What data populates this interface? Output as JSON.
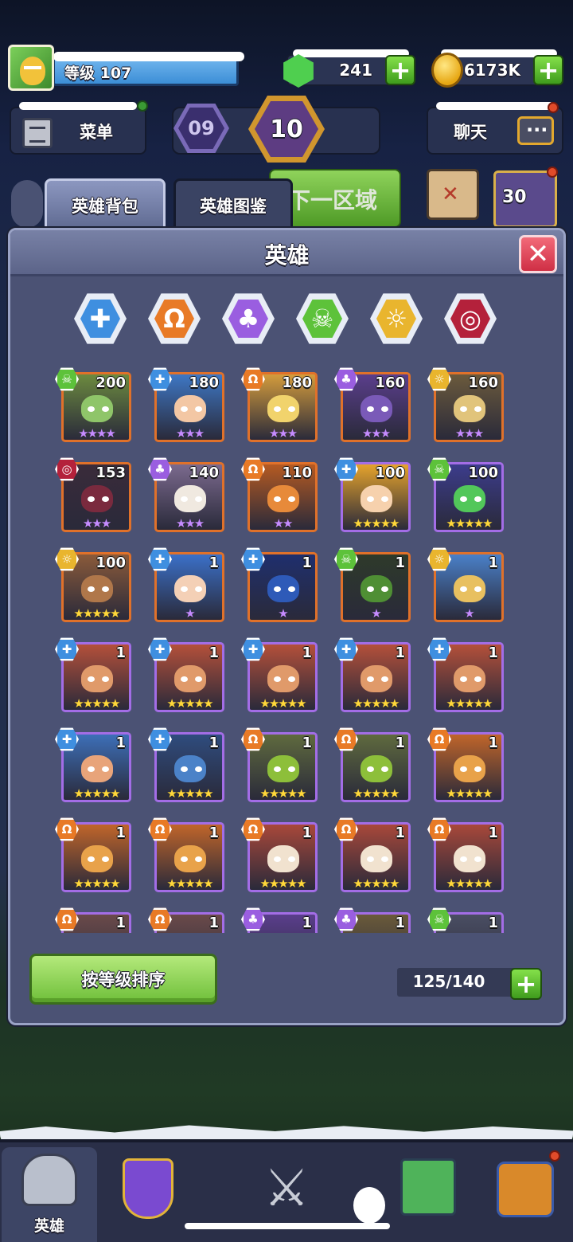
{
  "hud": {
    "level_label": "等级",
    "level_value": "107",
    "gems": "241",
    "gold": "6173K"
  },
  "top_buttons": {
    "menu": "菜单",
    "chat": "聊天",
    "stage_prev": "09",
    "stage_current": "10",
    "next_zone": "下一区域",
    "event_days": "30"
  },
  "tabs": {
    "backpack": "英雄背包",
    "codex": "英雄图鉴"
  },
  "panel": {
    "title": "英雄",
    "close": "✕"
  },
  "filters": [
    {
      "name": "water",
      "symbol": "✚",
      "color": "#3f8fe0"
    },
    {
      "name": "fire",
      "symbol": "Ω",
      "color": "#e87a26"
    },
    {
      "name": "nature",
      "symbol": "♣",
      "color": "#9a5ee0"
    },
    {
      "name": "poison",
      "symbol": "☠",
      "color": "#5dc23a"
    },
    {
      "name": "light",
      "symbol": "☼",
      "color": "#e9b52e"
    },
    {
      "name": "dark",
      "symbol": "◎",
      "color": "#b4213b"
    }
  ],
  "heroes": [
    {
      "level": "200",
      "stars": "★★★★",
      "star_color": "#c58bff",
      "element": "poison",
      "frame": "orange",
      "bg": "#6c8a3f",
      "skin": "#8fc569"
    },
    {
      "level": "180",
      "stars": "★★★",
      "star_color": "#c58bff",
      "element": "water",
      "frame": "orange",
      "bg": "#3e77c4",
      "skin": "#f3c7a4"
    },
    {
      "level": "180",
      "stars": "★★★",
      "star_color": "#c58bff",
      "element": "fire",
      "frame": "orange",
      "bg": "#d49c3c",
      "skin": "#f1d36c"
    },
    {
      "level": "160",
      "stars": "★★★",
      "star_color": "#c58bff",
      "element": "nature",
      "frame": "orange",
      "bg": "#5a3e8c",
      "skin": "#7a5ab8"
    },
    {
      "level": "160",
      "stars": "★★★",
      "star_color": "#c58bff",
      "element": "light",
      "frame": "orange",
      "bg": "#6b5a3c",
      "skin": "#e1c47b"
    },
    {
      "level": "153",
      "stars": "★★★",
      "star_color": "#c58bff",
      "element": "dark",
      "frame": "orange",
      "bg": "#3a2b3a",
      "skin": "#7a2a3e"
    },
    {
      "level": "140",
      "stars": "★★★",
      "star_color": "#c58bff",
      "element": "nature",
      "frame": "orange",
      "bg": "#7b6a8e",
      "skin": "#f0e9e0"
    },
    {
      "level": "110",
      "stars": "★★",
      "star_color": "#c58bff",
      "element": "fire",
      "frame": "orange",
      "bg": "#b55a22",
      "skin": "#e78a3a"
    },
    {
      "level": "100",
      "stars": "★★★★★",
      "star_color": "#ffd83a",
      "element": "water",
      "frame": "purple",
      "bg": "#e5a32c",
      "skin": "#f6d1ad"
    },
    {
      "level": "100",
      "stars": "★★★★★",
      "star_color": "#ffd83a",
      "element": "poison",
      "frame": "purple",
      "bg": "#3c3c8c",
      "skin": "#52c75a"
    },
    {
      "level": "100",
      "stars": "★★★★★",
      "star_color": "#ffd83a",
      "element": "light",
      "frame": "orange",
      "bg": "#8a5a3a",
      "skin": "#b0774a"
    },
    {
      "level": "1",
      "stars": "★",
      "star_color": "#c58bff",
      "element": "water",
      "frame": "orange",
      "bg": "#3b70c8",
      "skin": "#f4d0b6"
    },
    {
      "level": "1",
      "stars": "★",
      "star_color": "#c58bff",
      "element": "water",
      "frame": "orange",
      "bg": "#1f2f6e",
      "skin": "#2e5ab8"
    },
    {
      "level": "1",
      "stars": "★",
      "star_color": "#c58bff",
      "element": "poison",
      "frame": "orange",
      "bg": "#2e3a2a",
      "skin": "#4f8f34"
    },
    {
      "level": "1",
      "stars": "★",
      "star_color": "#c58bff",
      "element": "light",
      "frame": "orange",
      "bg": "#4a80c8",
      "skin": "#e8c060"
    },
    {
      "level": "1",
      "stars": "★★★★★",
      "star_color": "#ffd83a",
      "element": "water",
      "frame": "purple",
      "bg": "#b4503a",
      "skin": "#e09a6a"
    },
    {
      "level": "1",
      "stars": "★★★★★",
      "star_color": "#ffd83a",
      "element": "water",
      "frame": "purple",
      "bg": "#b4503a",
      "skin": "#e09a6a"
    },
    {
      "level": "1",
      "stars": "★★★★★",
      "star_color": "#ffd83a",
      "element": "water",
      "frame": "purple",
      "bg": "#b4503a",
      "skin": "#e09a6a"
    },
    {
      "level": "1",
      "stars": "★★★★★",
      "star_color": "#ffd83a",
      "element": "water",
      "frame": "purple",
      "bg": "#b4503a",
      "skin": "#e09a6a"
    },
    {
      "level": "1",
      "stars": "★★★★★",
      "star_color": "#ffd83a",
      "element": "water",
      "frame": "purple",
      "bg": "#b4503a",
      "skin": "#e09a6a"
    },
    {
      "level": "1",
      "stars": "★★★★★",
      "star_color": "#ffd83a",
      "element": "water",
      "frame": "purple",
      "bg": "#3d6fb8",
      "skin": "#e8a47a"
    },
    {
      "level": "1",
      "stars": "★★★★★",
      "star_color": "#ffd83a",
      "element": "water",
      "frame": "purple",
      "bg": "#2f4c7e",
      "skin": "#4b82c8"
    },
    {
      "level": "1",
      "stars": "★★★★★",
      "star_color": "#ffd83a",
      "element": "fire",
      "frame": "purple",
      "bg": "#5f6a3e",
      "skin": "#8dbf3a"
    },
    {
      "level": "1",
      "stars": "★★★★★",
      "star_color": "#ffd83a",
      "element": "fire",
      "frame": "purple",
      "bg": "#5f6a3e",
      "skin": "#8dbf3a"
    },
    {
      "level": "1",
      "stars": "★★★★★",
      "star_color": "#ffd83a",
      "element": "fire",
      "frame": "purple",
      "bg": "#c0652a",
      "skin": "#e8a24a"
    },
    {
      "level": "1",
      "stars": "★★★★★",
      "star_color": "#ffd83a",
      "element": "fire",
      "frame": "purple",
      "bg": "#c0652a",
      "skin": "#e8a24a"
    },
    {
      "level": "1",
      "stars": "★★★★★",
      "star_color": "#ffd83a",
      "element": "fire",
      "frame": "purple",
      "bg": "#c0652a",
      "skin": "#e8a24a"
    },
    {
      "level": "1",
      "stars": "★★★★★",
      "star_color": "#ffd83a",
      "element": "fire",
      "frame": "purple",
      "bg": "#a8483a",
      "skin": "#f1e2cf"
    },
    {
      "level": "1",
      "stars": "★★★★★",
      "star_color": "#ffd83a",
      "element": "fire",
      "frame": "purple",
      "bg": "#a8483a",
      "skin": "#f1e2cf"
    },
    {
      "level": "1",
      "stars": "★★★★★",
      "star_color": "#ffd83a",
      "element": "fire",
      "frame": "purple",
      "bg": "#a8483a",
      "skin": "#f1e2cf"
    },
    {
      "level": "1",
      "stars": "",
      "star_color": "#ffd83a",
      "element": "fire",
      "frame": "purple",
      "bg": "#6a4a4a",
      "skin": "#b0a0a0"
    },
    {
      "level": "1",
      "stars": "",
      "star_color": "#ffd83a",
      "element": "fire",
      "frame": "purple",
      "bg": "#6a4a4a",
      "skin": "#b0a0a0"
    },
    {
      "level": "1",
      "stars": "",
      "star_color": "#ffd83a",
      "element": "nature",
      "frame": "purple",
      "bg": "#5a3e8c",
      "skin": "#9a6ad0"
    },
    {
      "level": "1",
      "stars": "",
      "star_color": "#ffd83a",
      "element": "nature",
      "frame": "purple",
      "bg": "#6a5a3a",
      "skin": "#e8c040"
    },
    {
      "level": "1",
      "stars": "",
      "star_color": "#ffd83a",
      "element": "poison",
      "frame": "purple",
      "bg": "#4a4e63",
      "skin": "#c0c4d0"
    }
  ],
  "element_colors": {
    "water": "#3f8fe0",
    "fire": "#e87a26",
    "nature": "#9a5ee0",
    "poison": "#5dc23a",
    "light": "#e9b52e",
    "dark": "#b4213b"
  },
  "element_symbols": {
    "water": "✚",
    "fire": "Ω",
    "nature": "♣",
    "poison": "☠",
    "light": "☼",
    "dark": "◎"
  },
  "footer": {
    "sort_label": "按等级排序",
    "capacity": "125/140"
  },
  "bottom_nav": {
    "heroes_label": "英雄"
  }
}
